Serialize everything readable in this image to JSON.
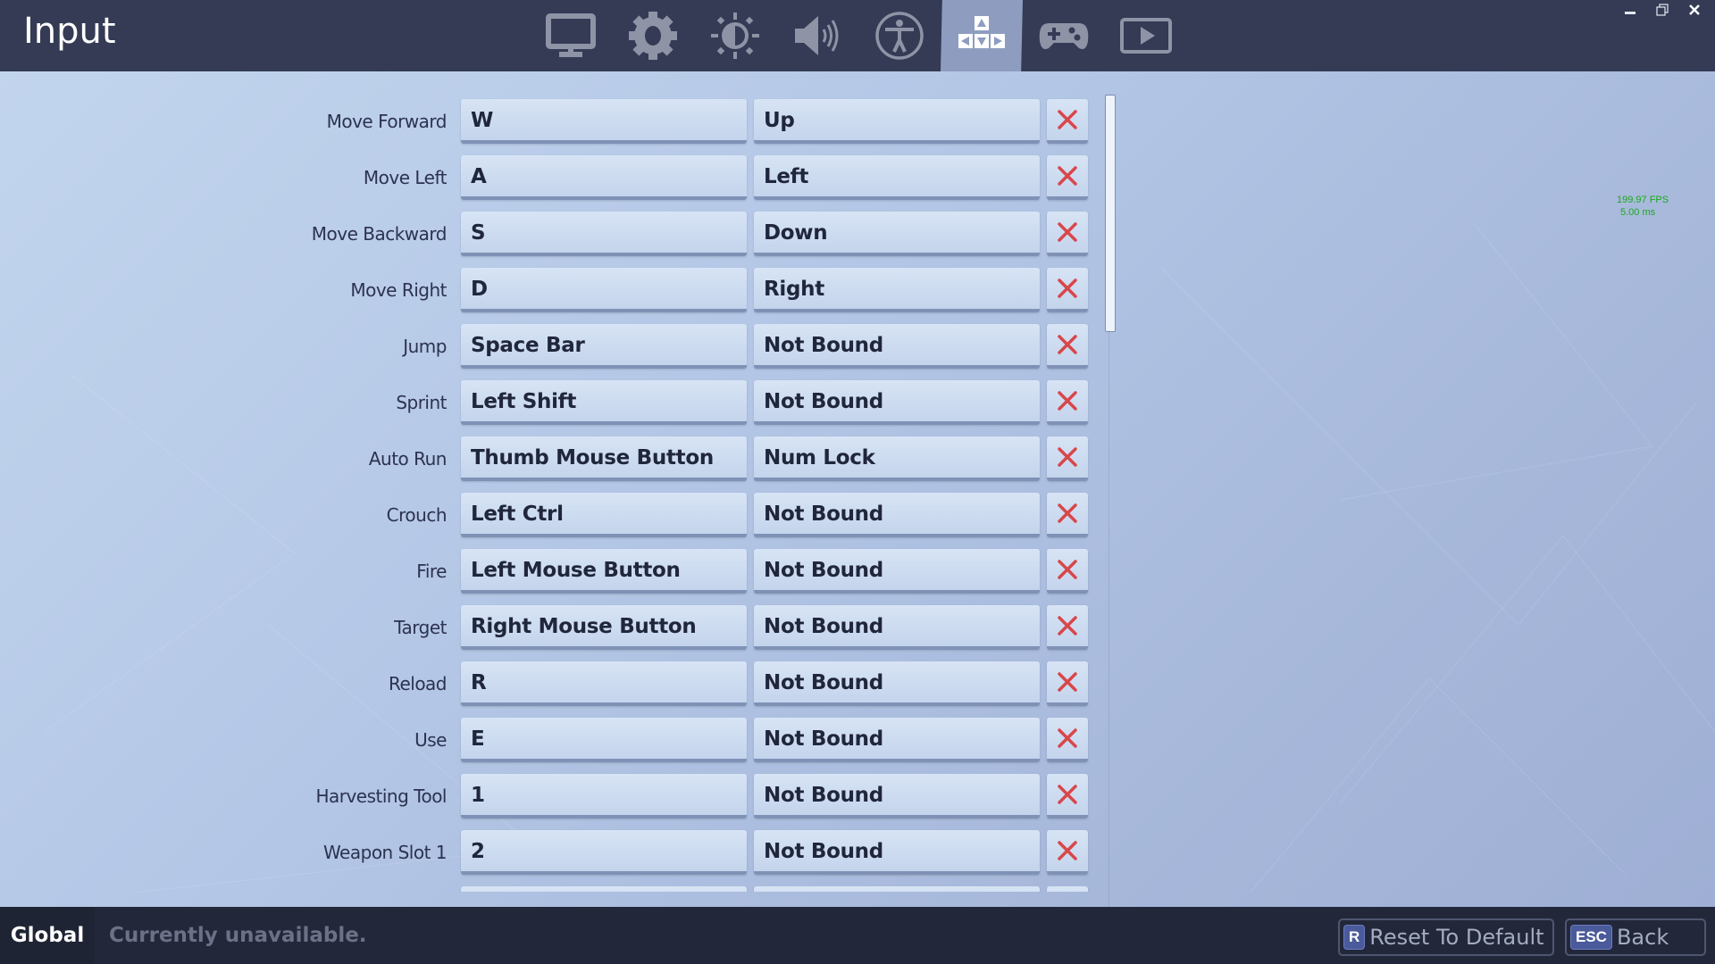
{
  "header": {
    "title": "Input",
    "tabs": [
      {
        "icon": "monitor-icon",
        "label": "Video",
        "active": false
      },
      {
        "icon": "gear-icon",
        "label": "Game",
        "active": false
      },
      {
        "icon": "brightness-icon",
        "label": "Brightness",
        "active": false
      },
      {
        "icon": "speaker-icon",
        "label": "Audio",
        "active": false
      },
      {
        "icon": "accessibility-icon",
        "label": "Accessibility",
        "active": false
      },
      {
        "icon": "arrow-keys-icon",
        "label": "Input",
        "active": true
      },
      {
        "icon": "gamepad-icon",
        "label": "Controller",
        "active": false
      },
      {
        "icon": "play-icon",
        "label": "Replay",
        "active": false
      }
    ],
    "window_controls": [
      "minimize",
      "restore",
      "close"
    ]
  },
  "bindings": [
    {
      "action": "Move Forward",
      "primary": "W",
      "secondary": "Up"
    },
    {
      "action": "Move Left",
      "primary": "A",
      "secondary": "Left"
    },
    {
      "action": "Move Backward",
      "primary": "S",
      "secondary": "Down"
    },
    {
      "action": "Move Right",
      "primary": "D",
      "secondary": "Right"
    },
    {
      "action": "Jump",
      "primary": "Space Bar",
      "secondary": "Not Bound"
    },
    {
      "action": "Sprint",
      "primary": "Left Shift",
      "secondary": "Not Bound"
    },
    {
      "action": "Auto Run",
      "primary": "Thumb Mouse Button",
      "secondary": "Num Lock"
    },
    {
      "action": "Crouch",
      "primary": "Left Ctrl",
      "secondary": "Not Bound"
    },
    {
      "action": "Fire",
      "primary": "Left Mouse Button",
      "secondary": "Not Bound"
    },
    {
      "action": "Target",
      "primary": "Right Mouse Button",
      "secondary": "Not Bound"
    },
    {
      "action": "Reload",
      "primary": "R",
      "secondary": "Not Bound"
    },
    {
      "action": "Use",
      "primary": "E",
      "secondary": "Not Bound"
    },
    {
      "action": "Harvesting Tool",
      "primary": "1",
      "secondary": "Not Bound"
    },
    {
      "action": "Weapon Slot 1",
      "primary": "2",
      "secondary": "Not Bound"
    }
  ],
  "fps_overlay": {
    "fps": "199.97 FPS",
    "frame_time": "5.00 ms"
  },
  "footer": {
    "scope_label": "Global",
    "status": "Currently unavailable.",
    "reset": {
      "key": "R",
      "label": "Reset To Default"
    },
    "back": {
      "key": "ESC",
      "label": "Back"
    }
  },
  "colors": {
    "header_bg": "#353b55",
    "active_tab": "#8e9dbf",
    "clear_x": "#d9464a",
    "fps_text": "#1aaa1a",
    "footer_bg": "#22283a"
  }
}
